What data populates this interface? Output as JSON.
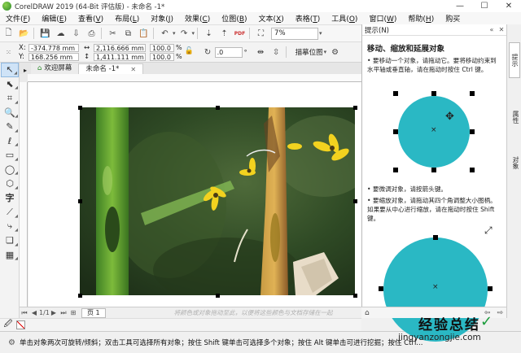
{
  "window": {
    "title": "CorelDRAW 2019 (64-Bit 评估版) - 未命名 -1*",
    "minimize": "—",
    "maximize": "☐",
    "close": "✕"
  },
  "menu": [
    {
      "label": "文件",
      "key": "F"
    },
    {
      "label": "编辑",
      "key": "E"
    },
    {
      "label": "查看",
      "key": "V"
    },
    {
      "label": "布局",
      "key": "L"
    },
    {
      "label": "对象",
      "key": "J"
    },
    {
      "label": "效果",
      "key": "C"
    },
    {
      "label": "位图",
      "key": "B"
    },
    {
      "label": "文本",
      "key": "X"
    },
    {
      "label": "表格",
      "key": "T"
    },
    {
      "label": "工具",
      "key": "O"
    },
    {
      "label": "窗口",
      "key": "W"
    },
    {
      "label": "帮助",
      "key": "H"
    },
    {
      "label": "购买",
      "key": ""
    }
  ],
  "toolbar": {
    "zoom": "7%",
    "pdf_label": "PDF"
  },
  "property_bar": {
    "x": "-374.778 mm",
    "y": "168.256 mm",
    "width": "2,116.666 mm",
    "height": "1,411.111 mm",
    "scale_w": "100.0",
    "scale_h": "100.0",
    "percent": "%",
    "x_label": "X:",
    "y_label": "Y:",
    "angle": ".0",
    "degree": "°",
    "describe_position": "描摹位图"
  },
  "tabs": {
    "welcome": "欢迎屏幕",
    "document": "未命名 -1*"
  },
  "page_bar": {
    "page_label": "页 1",
    "hint": "将颜色或对象拖动至此，以便将这些颜色与文档存储在一起"
  },
  "status": {
    "text": "单击对象两次可旋转/倾斜；双击工具可选择所有对象；按住 Shift 键单击可选择多个对象；按住 Alt 键单击可进行挖掘；按住 Ctrl..."
  },
  "hints_panel": {
    "header": "提示(N)",
    "title": "移动、缩放和延展对象",
    "para1": "• 要移动一个对象，请拖动它。要将移动约束到水平轴或垂直轴，请在拖动时按住 Ctrl 键。",
    "para2": "• 要微调对象，请按箭头键。",
    "para3": "• 要缩放对象，请拖动其四个角调整大小图柄。如果要从中心进行缩放，请在拖动时按住 Shift 键。"
  },
  "side_tabs": [
    "提示",
    "属性",
    "对象"
  ],
  "watermark": {
    "title": "经验总结",
    "url": "jingyanzongjie.com"
  },
  "colors": {
    "accent": "#2ab8c4",
    "selection": "#cfe3f7"
  }
}
